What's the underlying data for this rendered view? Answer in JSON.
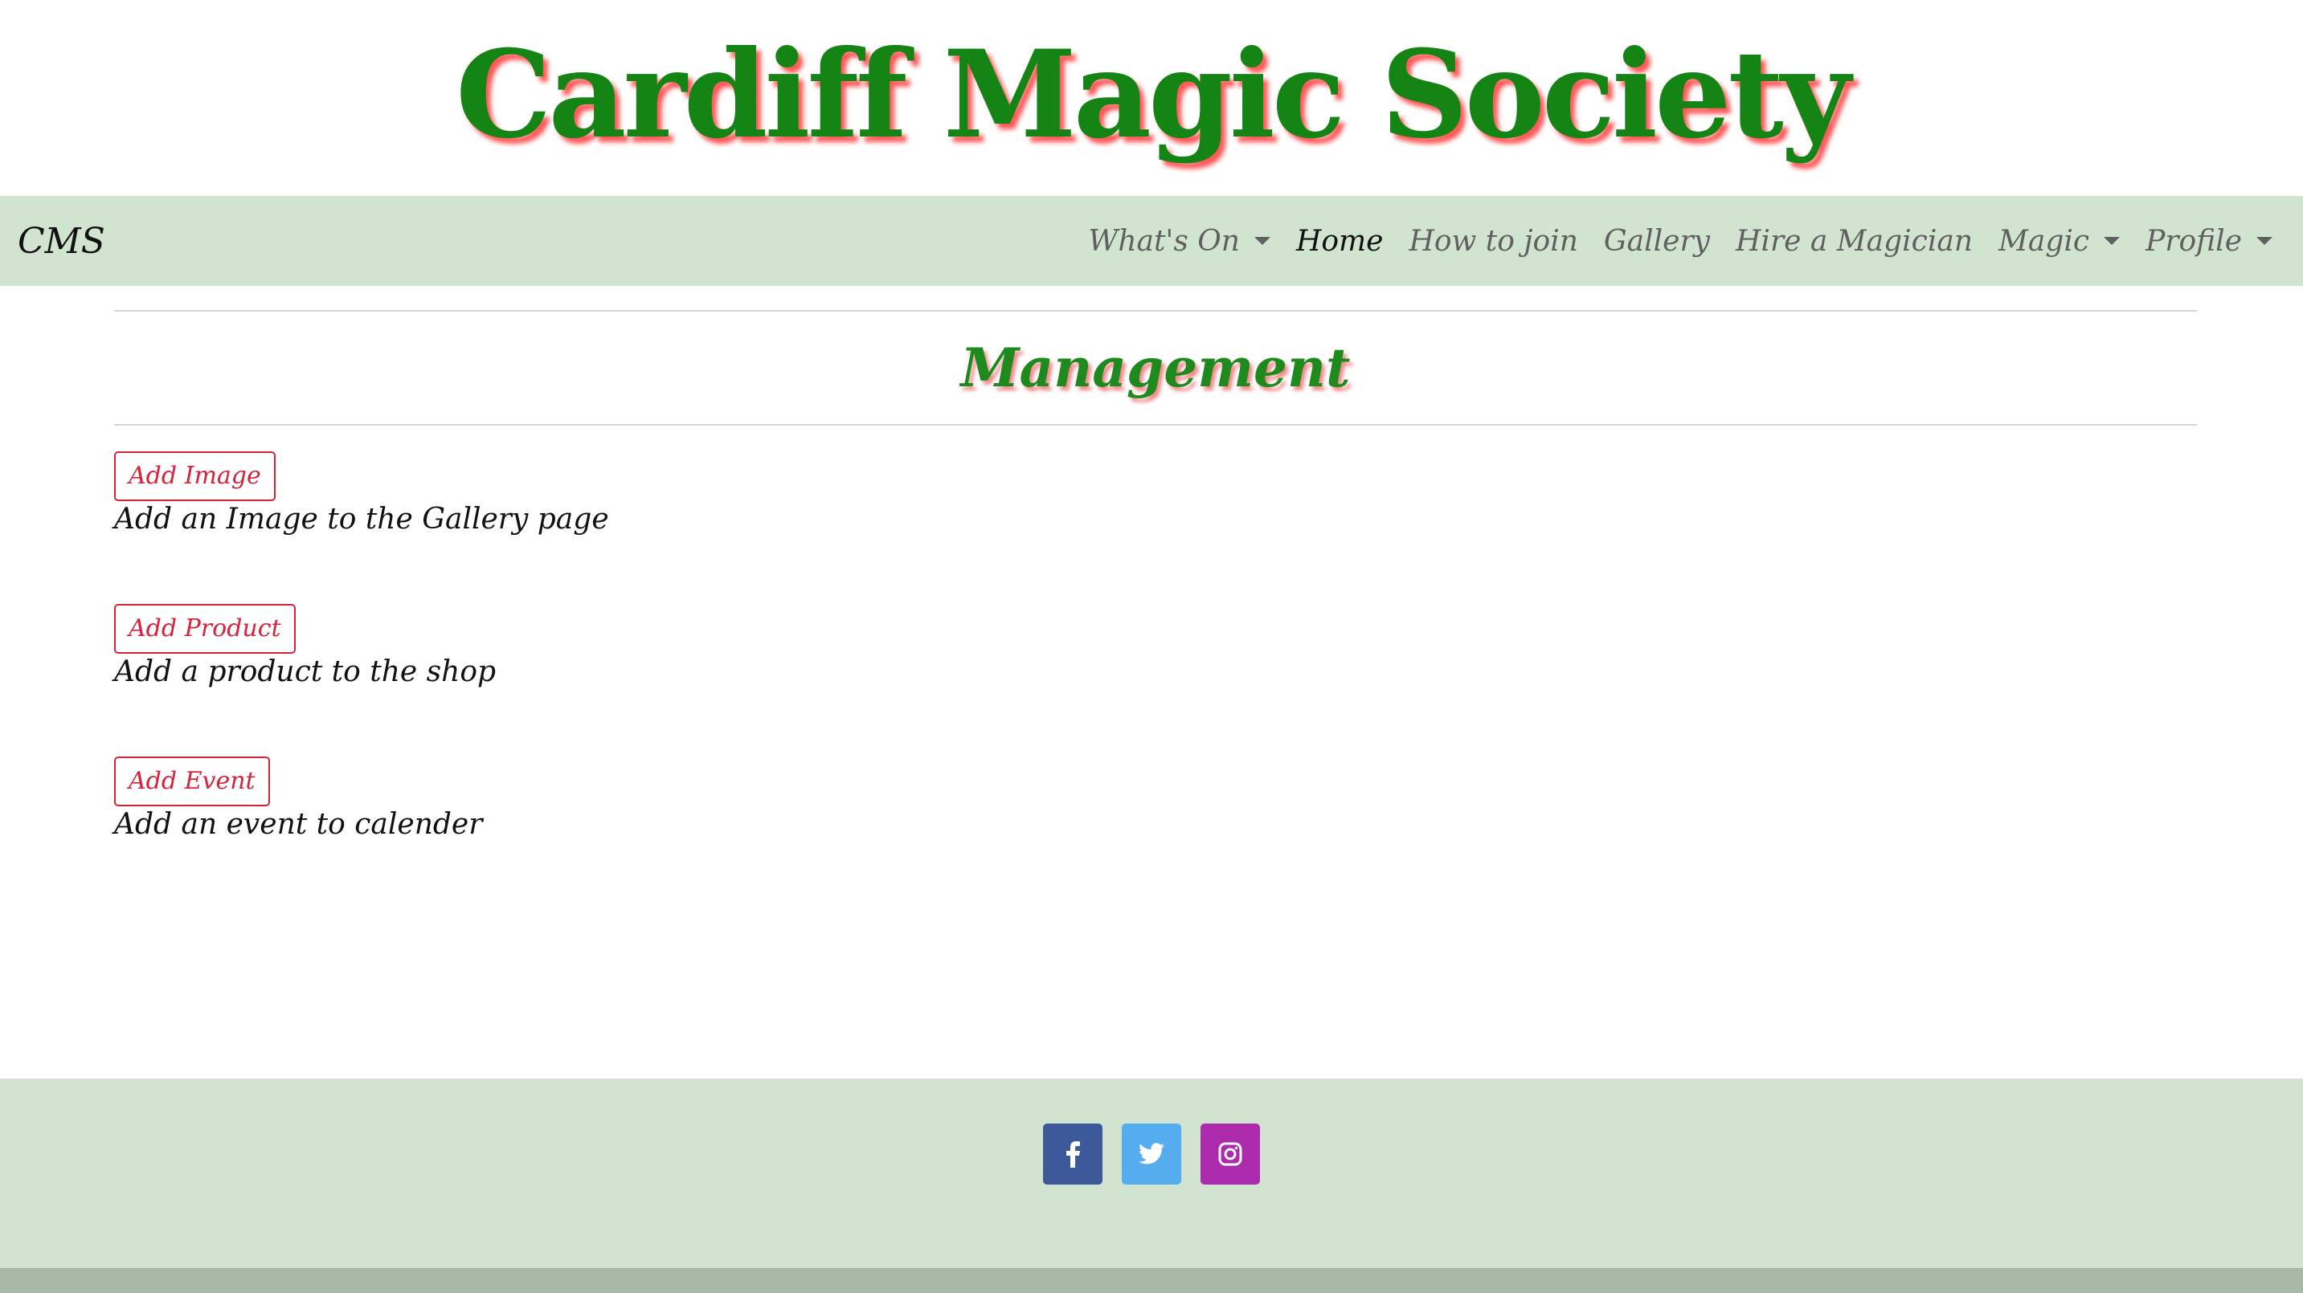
{
  "header": {
    "title": "Cardiff Magic Society"
  },
  "navbar": {
    "brand": "CMS",
    "items": [
      {
        "label": "What's On",
        "dropdown": true,
        "active": false
      },
      {
        "label": "Home",
        "dropdown": false,
        "active": true
      },
      {
        "label": "How to join",
        "dropdown": false,
        "active": false
      },
      {
        "label": "Gallery",
        "dropdown": false,
        "active": false
      },
      {
        "label": "Hire a Magician",
        "dropdown": false,
        "active": false
      },
      {
        "label": "Magic",
        "dropdown": true,
        "active": false
      },
      {
        "label": "Profile",
        "dropdown": true,
        "active": false
      }
    ]
  },
  "main": {
    "title": "Management",
    "actions": [
      {
        "button": "Add Image",
        "description": "Add an Image to the Gallery page"
      },
      {
        "button": "Add Product",
        "description": "Add a product to the shop"
      },
      {
        "button": "Add Event",
        "description": "Add an event to calender"
      }
    ]
  },
  "footer": {
    "social": [
      {
        "icon": "facebook-icon",
        "color": "#3b5998"
      },
      {
        "icon": "twitter-icon",
        "color": "#55acee"
      },
      {
        "icon": "instagram-icon",
        "color": "#ac2bac"
      }
    ]
  },
  "colors": {
    "title_green": "#148414",
    "title_shadow": "#ff5a5a",
    "nav_bg": "#d0e4d0",
    "button_red": "#d3243c",
    "footer_bar": "#a6b8a6"
  }
}
